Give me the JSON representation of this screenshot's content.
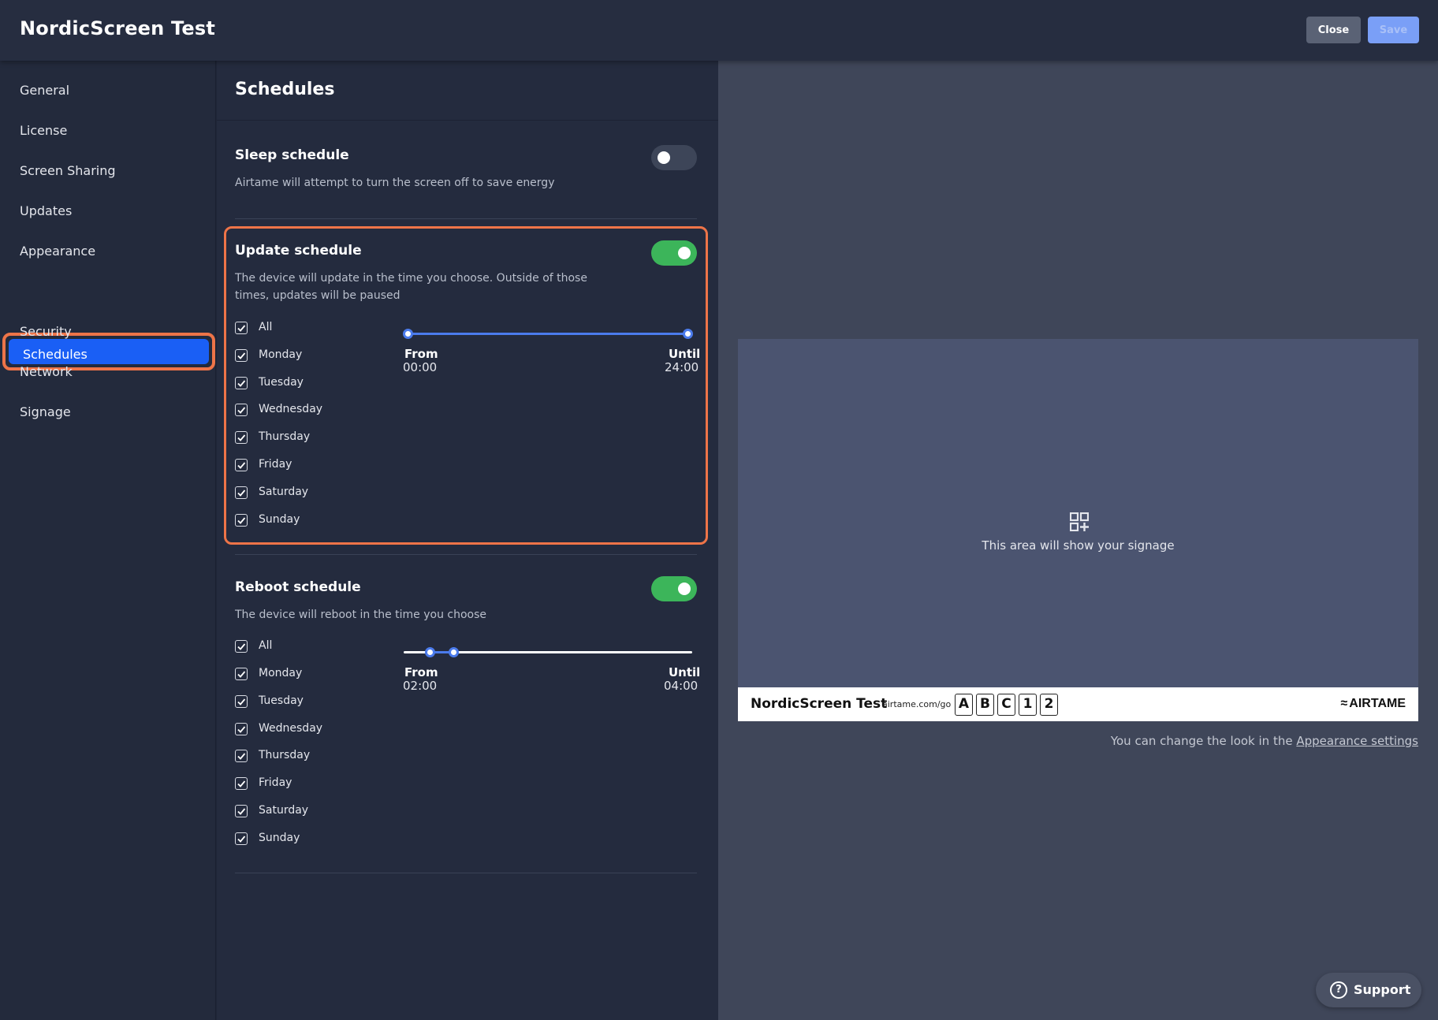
{
  "header": {
    "title": "NordicScreen Test",
    "close_label": "Close",
    "save_label": "Save"
  },
  "sidebar": {
    "items": [
      {
        "label": "General"
      },
      {
        "label": "License"
      },
      {
        "label": "Screen Sharing"
      },
      {
        "label": "Updates"
      },
      {
        "label": "Appearance"
      },
      {
        "label": "Schedules",
        "active": true
      },
      {
        "label": "Security"
      },
      {
        "label": "Network"
      },
      {
        "label": "Signage"
      }
    ]
  },
  "main": {
    "title": "Schedules",
    "sleep": {
      "title": "Sleep schedule",
      "description": "Airtame will attempt to turn the screen off to save energy",
      "enabled": false
    },
    "update": {
      "title": "Update schedule",
      "description": "The device will update in the time you choose. Outside of those times, updates will be paused",
      "enabled": true,
      "days": [
        "All",
        "Monday",
        "Tuesday",
        "Wednesday",
        "Thursday",
        "Friday",
        "Saturday",
        "Sunday"
      ],
      "from_label": "From",
      "from_value": "00:00",
      "until_label": "Until",
      "until_value": "24:00"
    },
    "reboot": {
      "title": "Reboot schedule",
      "description": "The device will reboot in the time you choose",
      "enabled": true,
      "days": [
        "All",
        "Monday",
        "Tuesday",
        "Wednesday",
        "Thursday",
        "Friday",
        "Saturday",
        "Sunday"
      ],
      "from_label": "From",
      "from_value": "02:00",
      "until_label": "Until",
      "until_value": "04:00"
    }
  },
  "preview": {
    "placeholder": "This area will show your signage",
    "device_name": "NordicScreen Test",
    "url": "airtame.com/go",
    "code": [
      "A",
      "B",
      "C",
      "1",
      "2"
    ],
    "brand": "AIRTAME",
    "note_prefix": "You can change the look in the",
    "note_link": "Appearance settings"
  },
  "support": {
    "label": "Support"
  },
  "colors": {
    "accent": "#1a5ff5",
    "highlight": "#ee7448",
    "toggle_on": "#3cb55a",
    "slider": "#4b7bec"
  }
}
